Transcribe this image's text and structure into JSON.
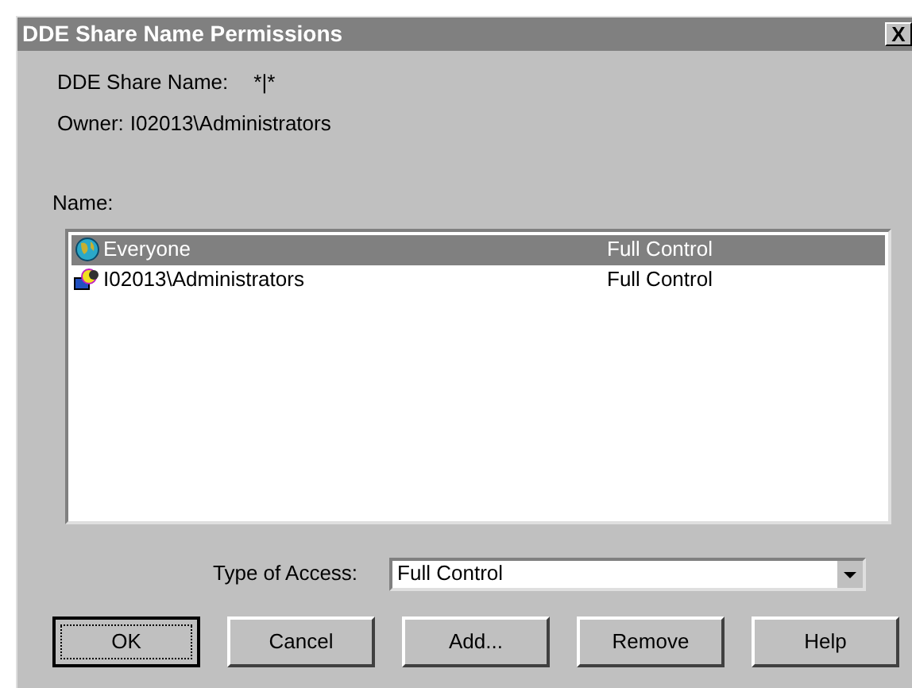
{
  "window": {
    "title": "DDE Share Name Permissions",
    "close": "X"
  },
  "share_name": {
    "label": "DDE Share Name:",
    "value": "*|*"
  },
  "owner": {
    "label": "Owner:",
    "value": "I02013\\Administrators"
  },
  "name_list": {
    "label": "Name:",
    "rows": [
      {
        "kind": "globe",
        "name": "Everyone",
        "access": "Full Control",
        "selected": true
      },
      {
        "kind": "group",
        "name": "I02013\\Administrators",
        "access": "Full Control",
        "selected": false
      }
    ]
  },
  "type_of_access": {
    "label": "Type of Access:",
    "value": "Full Control"
  },
  "buttons": [
    {
      "label": "OK",
      "default": true
    },
    {
      "label": "Cancel",
      "default": false
    },
    {
      "label": "Add...",
      "default": false
    },
    {
      "label": "Remove",
      "default": false
    },
    {
      "label": "Help",
      "default": false
    }
  ]
}
